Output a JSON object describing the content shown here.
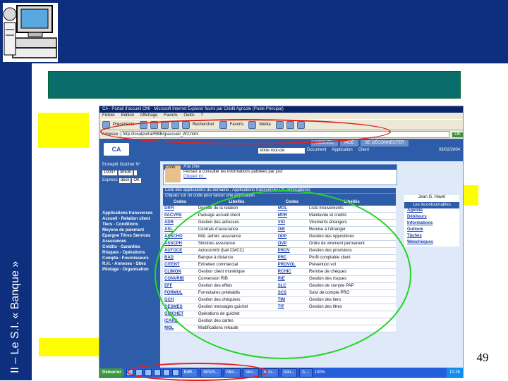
{
  "slide": {
    "side_title": "II – Le S.I. « Banque »",
    "page_number": "49"
  },
  "browser": {
    "title": "CA - Portail d'accueil CMI - Microsoft Internet Explorer fourni par Crédit Agricole (Poste Principal)",
    "menu": [
      "Fichier",
      "Edition",
      "Affichage",
      "Favoris",
      "Outils",
      "?"
    ],
    "toolbar": [
      "Précédente",
      "Rechercher",
      "Favoris",
      "Média"
    ],
    "address_label": "Adresse",
    "address": "http://localportal/RBB/g/accueil_W2.html",
    "go": "OK"
  },
  "portal": {
    "logo": "CA",
    "search_value": "Votre mot-clé",
    "tabs": [
      "ACCUEIL",
      "AIDE",
      "SE DÉCONNECTER"
    ],
    "radios": [
      "Document",
      "Application",
      "Client"
    ],
    "date": "03/02/2004",
    "left": {
      "headers": [
        "Entrepôt",
        "Guichet",
        "N°"
      ],
      "values": [
        "10037",
        "30530",
        ""
      ],
      "express_label": "Express",
      "express_value": "dock",
      "ok": "OK",
      "menu": [
        "Applications transverses",
        "Accueil - Relation client",
        "Tiers - Conditions",
        "Moyens de paiement",
        "Epargne Titres Services",
        "Assurances",
        "Crédits - Garanties",
        "Risques - Opérations",
        "Compta - Fournisseurs",
        "R.H. - Annexes - Sites",
        "Pilotage - Organisation"
      ]
    },
    "aune": {
      "title": "A la Une",
      "label": "Conn",
      "text": "Pensez à consulter les informations publiées par jour",
      "link": "Cliquez ici..."
    },
    "apps": {
      "title": "Liste des applications du domaine : Applications transverses (31 applications)",
      "hint": "Cliquez sur un code pour lancer une application",
      "columns": [
        "Codes",
        "Libellés",
        "Codes",
        "Libellés"
      ],
      "rows": [
        [
          "DRFI",
          "Dossier de la relation",
          "MOL",
          "Liste mouvements"
        ],
        [
          "PACVRS",
          "Package accueil client",
          "MPR",
          "Mainlevée et crédits"
        ],
        [
          "ADR",
          "Gestion des adresses",
          "VIO",
          "Virements étrangers"
        ],
        [
          "ASL",
          "Contrats d'assurance",
          "OIE",
          "Remise à l'étranger"
        ],
        [
          "ASSCHO",
          "Mût. admin. assurance",
          "OPP",
          "Gestion des oppositions"
        ],
        [
          "ASSCPH",
          "Sinistres assurance",
          "OVP",
          "Ordre de virement permanent"
        ],
        [
          "AUTOCE",
          "Autocontrôl (bail CMCC)",
          "PROV",
          "Gestion des provisions"
        ],
        [
          "BAD",
          "Banque à distance",
          "PRC",
          "Profil comptable client"
        ],
        [
          "CITENT",
          "Entretien commercial",
          "PROVOL",
          "Prévention vol"
        ],
        [
          "CLIMON",
          "Gestion client monétique",
          "RCHIC",
          "Remise de chèques"
        ],
        [
          "CONVRIB",
          "Conversion RIB",
          "RIE",
          "Gestion des risques"
        ],
        [
          "EFF",
          "Gestion des effets",
          "SLC",
          "Gestion de compte PAP"
        ],
        [
          "FORMUL",
          "Formulaires préétablis",
          "SCS",
          "Suivi de compte PRO"
        ],
        [
          "GCH",
          "Gestion des chéquiers",
          "TIM",
          "Gestion des tiers"
        ],
        [
          "GESMES",
          "Gestion messages guichet",
          "TIT",
          "Gestion des titres"
        ],
        [
          "GUICHET",
          "Opérations de guichet",
          "",
          ""
        ],
        [
          "ICARS",
          "Gestion des cartes",
          "",
          ""
        ],
        [
          "MGL",
          "Modifications rehaute",
          "",
          ""
        ]
      ]
    },
    "right": {
      "user": "Jean G. Havet",
      "header": "Les incontournables",
      "links": [
        "Agenda",
        "Débiteurs",
        "Informations",
        "Outlook",
        "Tâches",
        "Webchèques"
      ]
    },
    "taskbar": {
      "start": "Démarrer",
      "tasks": [
        "BdR...",
        "MAVS...",
        "Micr...",
        "Vior...",
        "Mco...",
        "Ado...",
        "A ..."
      ],
      "zoom": "100%",
      "tray": "10:26"
    }
  },
  "colors": {
    "slide_blue": "#0e2e7e",
    "banner_teal": "#0b6c6c",
    "highlight_yellow": "#fffe00",
    "annotation_red": "#e22222",
    "annotation_green": "#22d522"
  }
}
